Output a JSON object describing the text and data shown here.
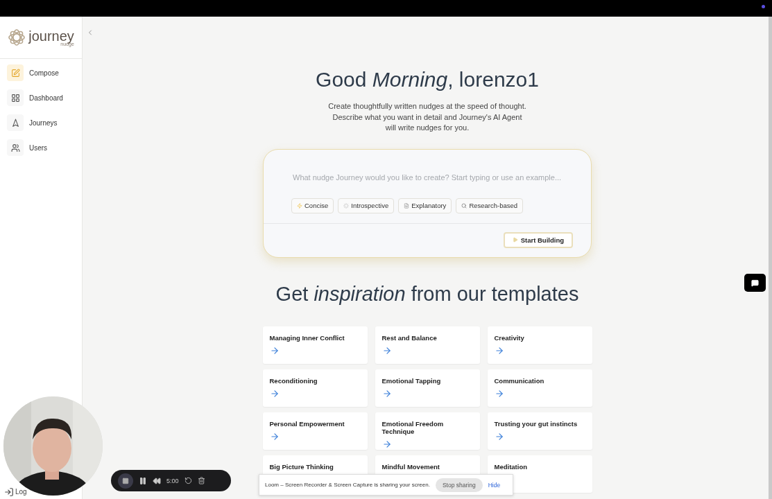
{
  "sidebar": {
    "logo": {
      "name": "journey",
      "tagline": "nudge"
    },
    "items": [
      {
        "label": "Compose",
        "selected": true
      },
      {
        "label": "Dashboard",
        "selected": false
      },
      {
        "label": "Journeys",
        "selected": false
      },
      {
        "label": "Users",
        "selected": false
      }
    ],
    "logout": "Log"
  },
  "greeting": {
    "title": "Good *Morning*, lorenzo1",
    "subtitle": [
      "Create thoughtfully written nudges at the speed of thought.",
      "Describe what you want in detail and Journey's AI Agent",
      "will write nudges for you."
    ]
  },
  "composer": {
    "placeholder": "What nudge Journey would you like to create? Start typing or use an example...",
    "styles": [
      "Concise",
      "Introspective",
      "Explanatory",
      "Research-based"
    ],
    "submit": "Start Building"
  },
  "templates": {
    "heading": "Get *inspiration* from our templates",
    "items": [
      "Managing Inner Conflict",
      "Rest and Balance",
      "Creativity",
      "Reconditioning",
      "Emotional Tapping",
      "Communication",
      "Personal Empowerment",
      "Emotional Freedom Technique",
      "Trusting your gut instincts",
      "Big Picture Thinking",
      "Mindful Movement",
      "Meditation"
    ]
  },
  "recorder": {
    "timer": "5:00"
  },
  "share_banner": {
    "message": "Loom – Screen Recorder & Screen Capture is sharing your screen.",
    "stop": "Stop sharing",
    "hide": "Hide"
  }
}
